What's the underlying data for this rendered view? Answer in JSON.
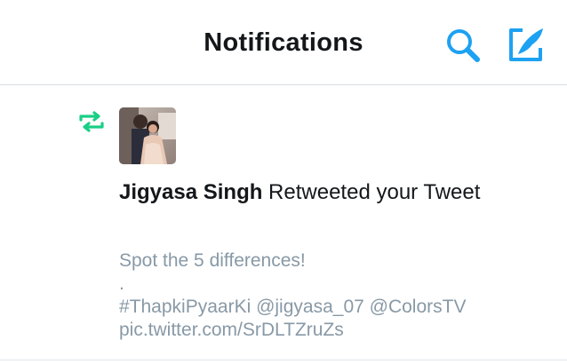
{
  "header": {
    "title": "Notifications",
    "search_icon": "search-icon",
    "compose_icon": "compose-tweet-icon",
    "accent_color": "#1da1f2"
  },
  "notification": {
    "type_icon": "retweet-icon",
    "type_color": "#19cf86",
    "user_name": "Jigyasa Singh",
    "action_text": " Retweeted your Tweet",
    "tweet_lines": [
      "Spot the 5 differences!",
      ".",
      "#ThapkiPyaarKi @jigyasa_07 @ColorsTV",
      "pic.twitter.com/SrDLTZruZs"
    ]
  }
}
